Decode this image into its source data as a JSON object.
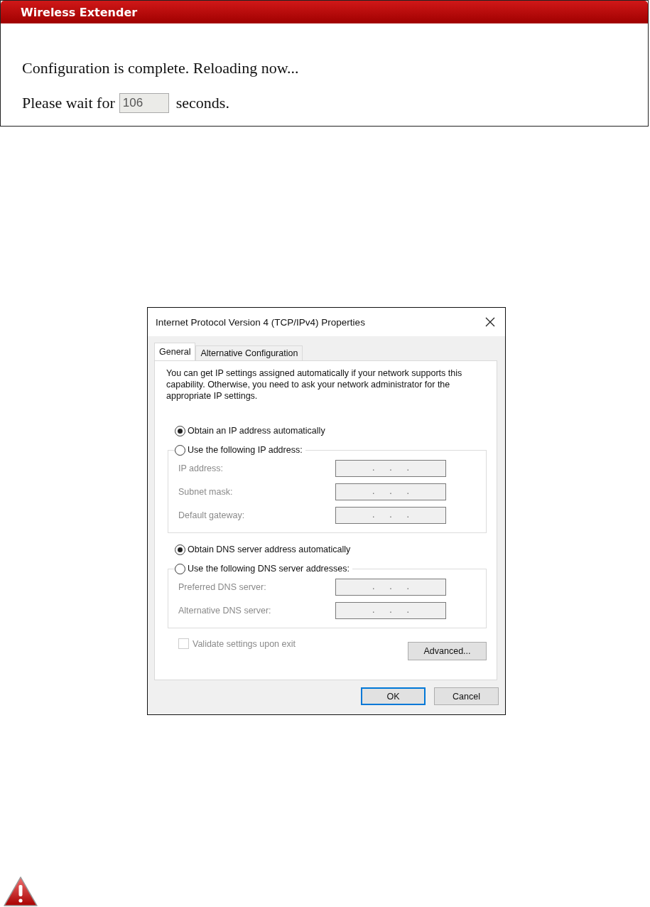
{
  "extender_panel": {
    "title": "Wireless Extender",
    "message": "Configuration is complete. Reloading now...",
    "wait_prefix": "Please wait for",
    "countdown": "106",
    "wait_suffix": "seconds."
  },
  "dialog": {
    "title": "Internet Protocol Version 4 (TCP/IPv4) Properties",
    "tabs": [
      {
        "label": "General",
        "selected": true
      },
      {
        "label": "Alternative Configuration",
        "selected": false
      }
    ],
    "description": "You can get IP settings assigned automatically if your network supports this capability. Otherwise, you need to ask your network administrator for the appropriate IP settings.",
    "groups": [
      {
        "auto_option": {
          "label": "Obtain an IP address automatically",
          "selected": true
        },
        "manual_option": {
          "label": "Use the following IP address:",
          "selected": false
        },
        "fields": [
          {
            "label": "IP address:",
            "value": ".      .      .",
            "disabled": true
          },
          {
            "label": "Subnet mask:",
            "value": ".      .      .",
            "disabled": true
          },
          {
            "label": "Default gateway:",
            "value": ".      .      .",
            "disabled": true
          }
        ]
      },
      {
        "auto_option": {
          "label": "Obtain DNS server address automatically",
          "selected": true
        },
        "manual_option": {
          "label": "Use the following DNS server addresses:",
          "selected": false
        },
        "fields": [
          {
            "label": "Preferred DNS server:",
            "value": ".      .      .",
            "disabled": true
          },
          {
            "label": "Alternative DNS server:",
            "value": ".      .      .",
            "disabled": true
          }
        ]
      }
    ],
    "validate": {
      "label": "Validate settings upon exit",
      "checked": false,
      "disabled": true
    },
    "advanced_button": "Advanced...",
    "buttons": [
      {
        "label": "OK",
        "default": true
      },
      {
        "label": "Cancel",
        "default": false
      }
    ]
  }
}
